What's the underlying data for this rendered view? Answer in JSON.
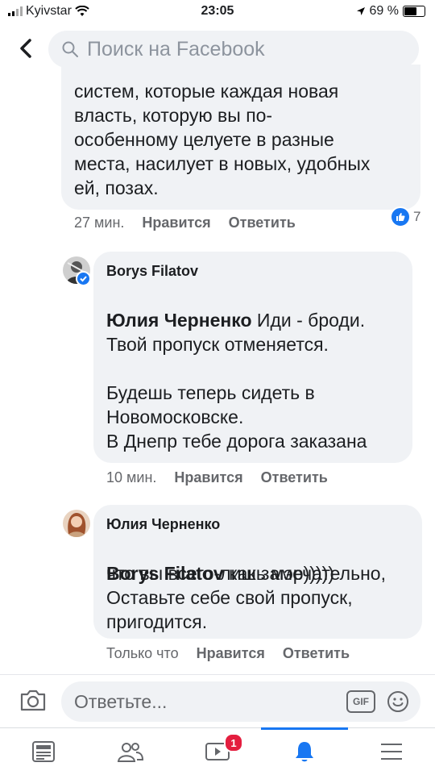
{
  "status_bar": {
    "carrier": "Kyivstar",
    "time": "23:05",
    "battery": "69 %",
    "battery_level": 0.69
  },
  "search": {
    "placeholder": "Поиск на Facebook"
  },
  "comments": [
    {
      "text": "систем, которые каждая новая\nвласть, которую вы по-\nособенному целуете в разные\nместа, насилует в новых, удобных\nей, позах.",
      "time": "27 мин.",
      "like": "Нравится",
      "reply": "Ответить",
      "reactions": "7"
    },
    {
      "author": "Borys Filatov",
      "mention": "Юлия Черненко",
      "text_after_mention": " Иди - броди.",
      "text": "Твой пропуск отменяется.\n\nБудешь теперь сидеть в\nНовомосковске.\nВ Днепр тебе дорога заказана",
      "time": "10 мин.",
      "like": "Нравится",
      "reply": "Ответить"
    },
    {
      "author": "Юлия Черненко",
      "mention": "Borys Filatov",
      "text_after_mention": " как замечательно,",
      "text": "что вы всего-лишь мэр)))))\nОставьте себе свой пропуск,\nпригодится.",
      "time": "Только что",
      "like": "Нравится",
      "reply": "Ответить"
    }
  ],
  "reply_bar": {
    "placeholder": "Ответьте...",
    "gif": "GIF"
  },
  "tab_bar": {
    "items": [
      "news-feed",
      "friends",
      "watch",
      "notifications",
      "menu"
    ],
    "watch_badge": "1",
    "active": "notifications"
  },
  "colors": {
    "accent": "#1877f2",
    "bubble": "#f0f2f5",
    "badge": "#e41e3f",
    "meta": "#65676b"
  }
}
